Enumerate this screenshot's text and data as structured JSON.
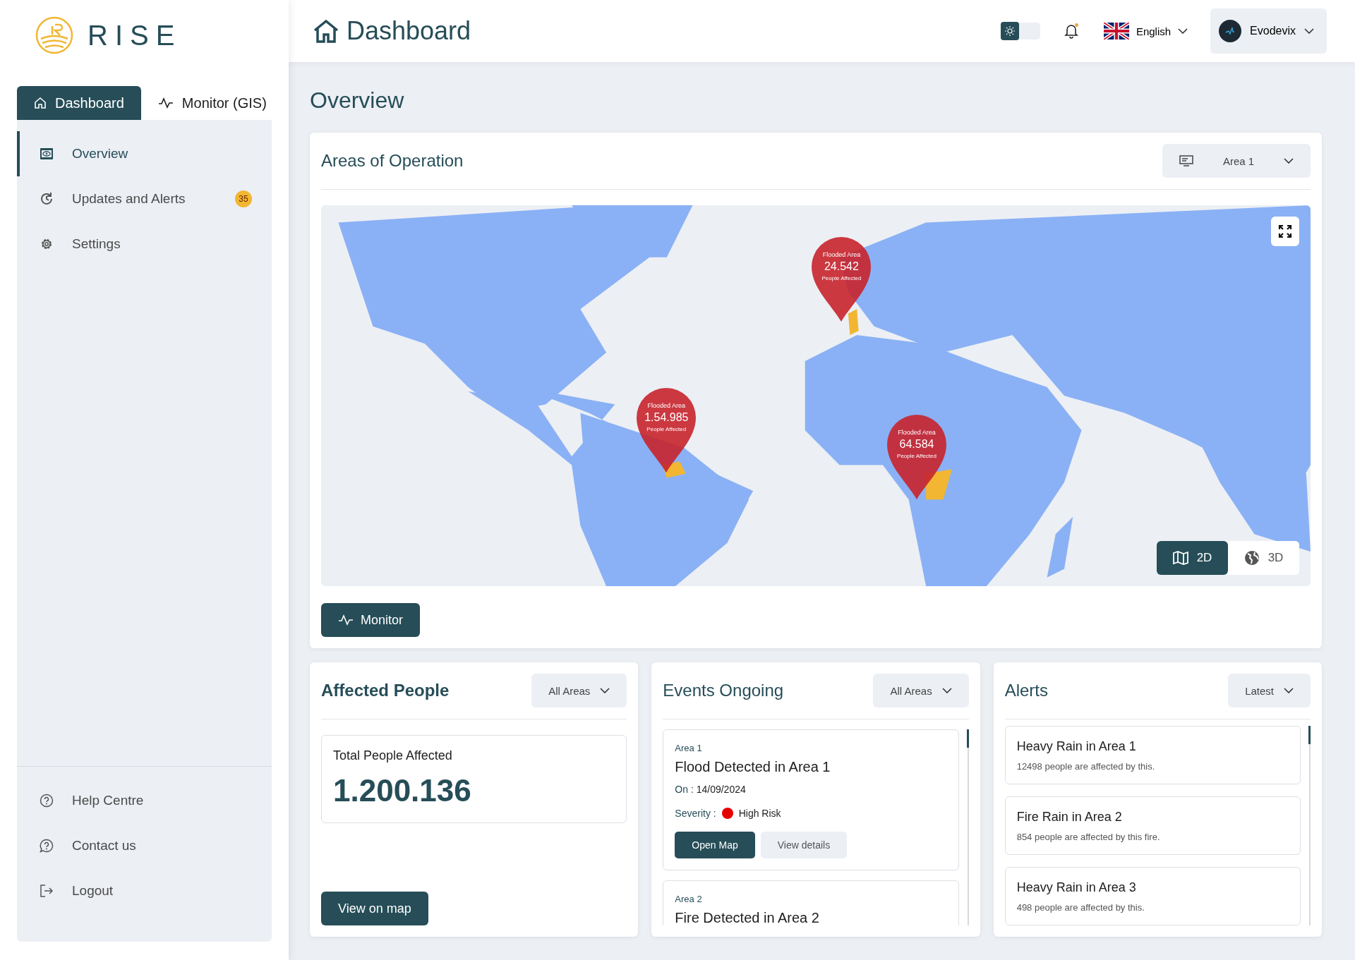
{
  "logo": {
    "text": "RISE"
  },
  "header": {
    "title": "Dashboard",
    "dark_mode": false,
    "unread_notifications": true,
    "language": "English",
    "user": "Evodevix"
  },
  "sidebar": {
    "tabs": [
      {
        "label": "Dashboard",
        "selected": true
      },
      {
        "label": "Monitor (GIS)",
        "selected": false
      }
    ],
    "items": [
      {
        "label": "Overview",
        "selected": true
      },
      {
        "label": "Updates and Alerts",
        "badge": "35",
        "selected": false
      },
      {
        "label": "Settings",
        "selected": false
      }
    ],
    "footer_items": [
      {
        "label": "Help Centre"
      },
      {
        "label": "Contact us"
      },
      {
        "label": "Logout"
      }
    ]
  },
  "page_title": "Overview",
  "map_card": {
    "title": "Areas of Operation",
    "area_select": "Area 1",
    "pins": [
      {
        "label": "Flooded Area",
        "value": "24.542",
        "caption": "People Affected"
      },
      {
        "label": "Flooded Area",
        "value": "1.54.985",
        "caption": "People Affected"
      },
      {
        "label": "Flooded Area",
        "value": "64.584",
        "caption": "People Affected"
      }
    ],
    "view_modes": [
      {
        "label": "2D",
        "selected": true
      },
      {
        "label": "3D",
        "selected": false
      }
    ],
    "monitor_button": "Monitor"
  },
  "affected": {
    "title": "Affected People",
    "filter": "All Areas",
    "stat_label": "Total People Affected",
    "stat_value": "1.200.136",
    "button": "View on map"
  },
  "events": {
    "title": "Events Ongoing",
    "filter": "All Areas",
    "items": [
      {
        "area": "Area 1",
        "title": "Flood Detected in Area 1",
        "date_label": "On :",
        "date": "14/09/2024",
        "severity_label": "Severity :",
        "severity": "High Risk",
        "color": "#e60000",
        "buttons": [
          "Open Map",
          "View details"
        ]
      },
      {
        "area": "Area 2",
        "title": "Fire Detected in Area 2"
      }
    ]
  },
  "alerts": {
    "title": "Alerts",
    "filter": "Latest",
    "items": [
      {
        "title": "Heavy Rain in Area 1",
        "text": "12498 people are affected by this."
      },
      {
        "title": "Fire Rain in Area 2",
        "text": "854 people are affected by this fire."
      },
      {
        "title": "Heavy Rain in Area 3",
        "text": "498 people are affected by this."
      }
    ]
  }
}
